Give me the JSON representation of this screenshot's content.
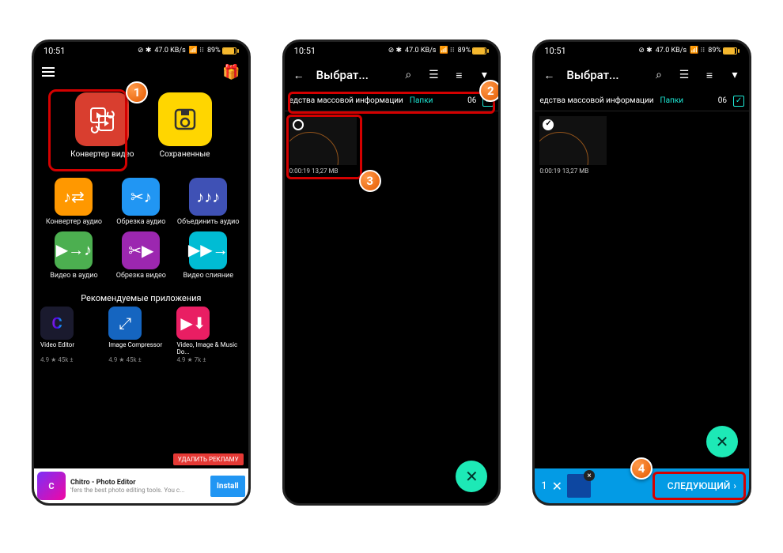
{
  "status": {
    "time": "10:51",
    "net": "47.0 KB/s",
    "battery": "89%"
  },
  "screen1": {
    "mainTiles": {
      "video_converter": "Конвертер видео",
      "saved": "Сохраненные"
    },
    "tools": {
      "audio_conv": "Конвертер аудио",
      "audio_trim": "Обрезка аудио",
      "audio_merge": "Объединить аудио",
      "vid_to_audio": "Видео в аудио",
      "vid_trim": "Обрезка видео",
      "vid_merge": "Видео слияние"
    },
    "recTitle": "Рекомендуемые приложения",
    "recs": [
      {
        "name": "Video Editor",
        "stats": "4.9 ★  45k ±"
      },
      {
        "name": "Image Compressor",
        "stats": "4.9 ★  45k ±"
      },
      {
        "name": "Video, Image & Music Do...",
        "stats": "4.9 ★  7k ±"
      }
    ],
    "removeAds": "УДАЛИТЬ РЕКЛАМУ",
    "ad": {
      "title": "Chitro - Photo Editor",
      "sub": "'fers the best photo editing tools. You c...",
      "install": "Install"
    }
  },
  "picker": {
    "title": "Выбрат...",
    "tabMedia": "едства массовой информации",
    "tabFolders": "Папки",
    "count": "06",
    "clip": {
      "duration": "0:00:19",
      "size": "13,27 MB"
    },
    "selected": "1",
    "next": "СЛЕДУЮЩИЙ"
  },
  "markers": {
    "m1": "1",
    "m2": "2",
    "m3": "3",
    "m4": "4"
  }
}
